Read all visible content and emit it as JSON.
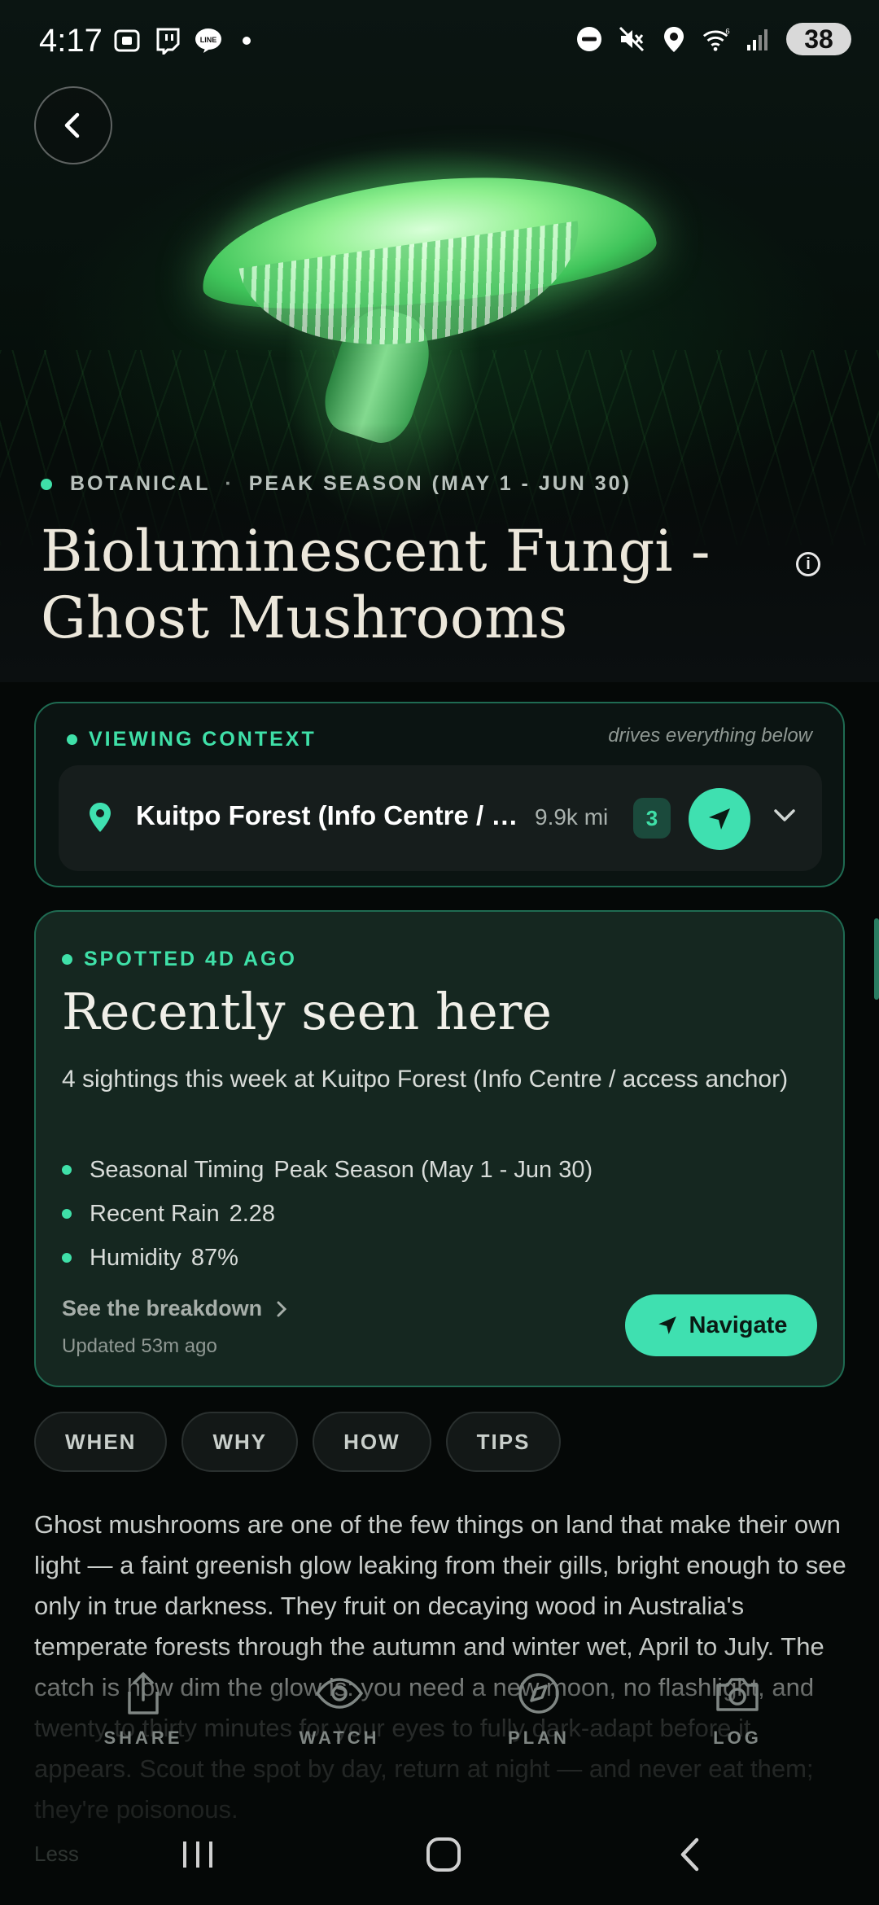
{
  "status_bar": {
    "time": "4:17",
    "battery": "38",
    "left_icons": [
      "screenshot-icon",
      "twitch-icon",
      "line-icon",
      "notification-dot"
    ],
    "right_icons": [
      "dnd-icon",
      "mute-icon",
      "location-icon",
      "wifi-icon",
      "signal-icon"
    ]
  },
  "hero": {
    "category": "BOTANICAL",
    "separator": "·",
    "season": "PEAK SEASON (MAY 1 - JUN 30)",
    "title": "Bioluminescent Fungi - Ghost Mushrooms"
  },
  "viewing_context": {
    "label": "VIEWING CONTEXT",
    "hint": "drives everything below",
    "location": "Kuitpo Forest (Info Centre / access anchor)",
    "distance": "9.9k mi",
    "count": "3"
  },
  "sighting": {
    "label": "SPOTTED 4D AGO",
    "title": "Recently seen here",
    "description": "4 sightings this week at Kuitpo Forest (Info Centre / access anchor)",
    "factors": [
      {
        "label": "Seasonal Timing",
        "value": "Peak Season (May 1 - Jun 30)"
      },
      {
        "label": "Recent Rain",
        "value": "2.28"
      },
      {
        "label": "Humidity",
        "value": "87%"
      }
    ],
    "breakdown_link": "See the breakdown",
    "updated": "Updated 53m ago",
    "navigate_label": "Navigate"
  },
  "tabs": [
    "WHEN",
    "WHY",
    "HOW",
    "TIPS"
  ],
  "body": {
    "text": "Ghost mushrooms are one of the few things on land that make their own light — a faint greenish glow leaking from their gills, bright enough to see only in true darkness. They fruit on decaying wood in Australia's temperate forests through the autumn and winter wet, April to July. The catch is how dim the glow is: you need a new moon, no flashlight, and twenty to thirty minutes for your eyes to fully dark-adapt before it appears. Scout the spot by day, return at night — and never eat them; they're poisonous.",
    "less_link": "Less"
  },
  "actions": [
    {
      "label": "SHARE",
      "icon": "share-icon"
    },
    {
      "label": "WATCH",
      "icon": "eye-icon"
    },
    {
      "label": "PLAN",
      "icon": "compass-icon"
    },
    {
      "label": "LOG",
      "icon": "camera-icon"
    }
  ],
  "colors": {
    "accent": "#3fe0b0",
    "card_border": "#1f6b52",
    "sighting_bg": "#152720",
    "background": "#050807"
  }
}
